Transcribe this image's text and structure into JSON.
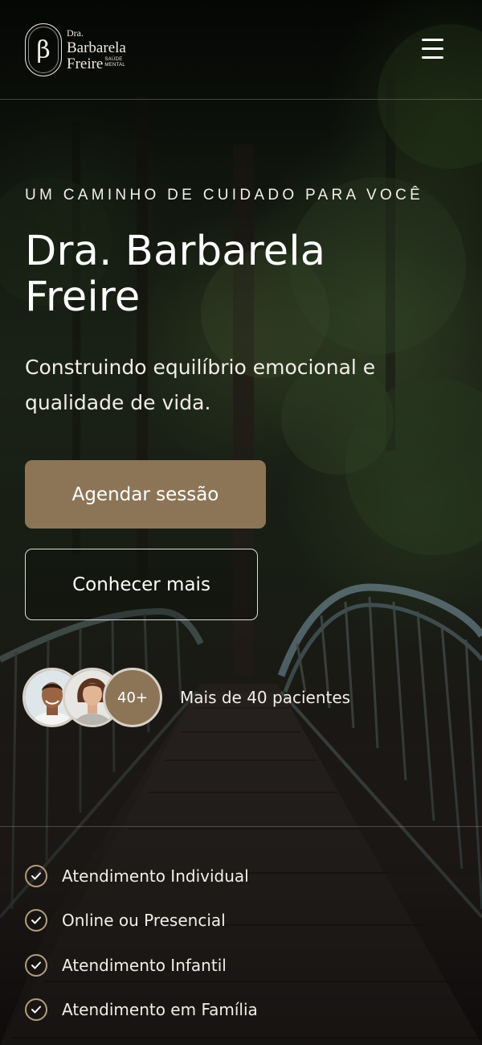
{
  "header": {
    "logo": {
      "monogram": "β",
      "line1": "Dra.",
      "line2": "Barbarela",
      "line3": "Freire",
      "tagline": "SAÚDE MENTAL"
    },
    "menu_icon": "hamburger-menu-icon"
  },
  "hero": {
    "eyebrow": "UM CAMINHO DE CUIDADO PARA VOCÊ",
    "title_line1": "Dra. Barbarela",
    "title_line2": "Freire",
    "subtitle": "Construindo equilíbrio emocional e qualidade de vida.",
    "primary_button": "Agendar sessão",
    "secondary_button": "Conhecer mais"
  },
  "social_proof": {
    "count_badge": "40+",
    "text": "Mais de 40 pacientes"
  },
  "features": [
    {
      "label": "Atendimento Individual",
      "icon": "check-circle-icon"
    },
    {
      "label": "Online ou Presencial",
      "icon": "check-circle-icon"
    },
    {
      "label": "Atendimento Infantil",
      "icon": "check-circle-icon"
    },
    {
      "label": "Atendimento em Família",
      "icon": "check-circle-icon"
    }
  ],
  "colors": {
    "accent": "#8c7557",
    "check": "#b59d7c",
    "text": "#ffffff"
  }
}
